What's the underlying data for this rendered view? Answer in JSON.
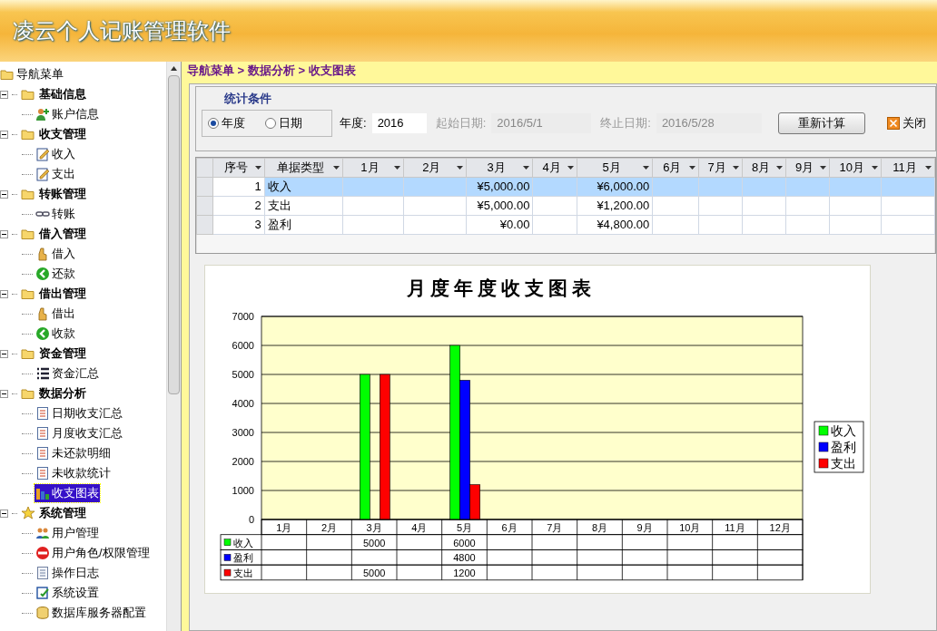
{
  "app_title": "凌云个人记账管理软件",
  "sidebar": {
    "label": "导航菜单",
    "children": [
      {
        "label": "基础信息",
        "expanded": true,
        "children": [
          {
            "label": "账户信息",
            "selected": false
          }
        ]
      },
      {
        "label": "收支管理",
        "expanded": true,
        "children": [
          {
            "label": "收入",
            "selected": false
          },
          {
            "label": "支出",
            "selected": false
          }
        ]
      },
      {
        "label": "转账管理",
        "expanded": true,
        "children": [
          {
            "label": "转账",
            "selected": false
          }
        ]
      },
      {
        "label": "借入管理",
        "expanded": true,
        "children": [
          {
            "label": "借入",
            "selected": false
          },
          {
            "label": "还款",
            "selected": false
          }
        ]
      },
      {
        "label": "借出管理",
        "expanded": true,
        "children": [
          {
            "label": "借出",
            "selected": false
          },
          {
            "label": "收款",
            "selected": false
          }
        ]
      },
      {
        "label": "资金管理",
        "expanded": true,
        "children": [
          {
            "label": "资金汇总",
            "selected": false
          }
        ]
      },
      {
        "label": "数据分析",
        "expanded": true,
        "children": [
          {
            "label": "日期收支汇总",
            "selected": false
          },
          {
            "label": "月度收支汇总",
            "selected": false
          },
          {
            "label": "未还款明细",
            "selected": false
          },
          {
            "label": "未收款统计",
            "selected": false
          },
          {
            "label": "收支图表",
            "selected": true
          }
        ]
      },
      {
        "label": "系统管理",
        "expanded": true,
        "children": [
          {
            "label": "用户管理",
            "selected": false
          },
          {
            "label": "用户角色/权限管理",
            "selected": false
          },
          {
            "label": "操作日志",
            "selected": false
          },
          {
            "label": "系统设置",
            "selected": false
          },
          {
            "label": "数据库服务器配置",
            "selected": false
          }
        ]
      }
    ]
  },
  "breadcrumb": "导航菜单 > 数据分析 > 收支图表",
  "filter": {
    "title": "统计条件",
    "modes": [
      {
        "label": "年度",
        "selected": true
      },
      {
        "label": "日期",
        "selected": false
      }
    ],
    "year": {
      "label": "年度:",
      "value": "2016",
      "disabled": false
    },
    "start": {
      "label": "起始日期:",
      "value": "2016/5/1",
      "disabled": true
    },
    "end": {
      "label": "终止日期:",
      "value": "2016/5/28",
      "disabled": true
    },
    "recalc_button": "重新计算",
    "close_button": "关闭"
  },
  "grid": {
    "columns": [
      "序号",
      "单据类型",
      "1月",
      "2月",
      "3月",
      "4月",
      "5月",
      "6月",
      "7月",
      "8月",
      "9月",
      "10月",
      "11月"
    ],
    "rows": [
      {
        "no": "1",
        "type": "收入",
        "selected": true,
        "month_3": "¥5,000.00",
        "month_5": "¥6,000.00"
      },
      {
        "no": "2",
        "type": "支出",
        "selected": false,
        "month_3": "¥5,000.00",
        "month_5": "¥1,200.00"
      },
      {
        "no": "3",
        "type": "盈利",
        "selected": false,
        "month_3": "¥0.00",
        "month_5": "¥4,800.00"
      }
    ]
  },
  "chart": {
    "chart_data": {
      "type": "bar",
      "title": "月度年度收支图表",
      "categories": [
        "1月",
        "2月",
        "3月",
        "4月",
        "5月",
        "6月",
        "7月",
        "8月",
        "9月",
        "10月",
        "11月",
        "12月"
      ],
      "series": [
        {
          "name": "收入",
          "color": "#00ff00",
          "values": [
            null,
            null,
            5000,
            null,
            6000,
            null,
            null,
            null,
            null,
            null,
            null,
            null
          ]
        },
        {
          "name": "盈利",
          "color": "#0000ff",
          "values": [
            null,
            null,
            null,
            null,
            4800,
            null,
            null,
            null,
            null,
            null,
            null,
            null
          ]
        },
        {
          "name": "支出",
          "color": "#ff0000",
          "values": [
            null,
            null,
            5000,
            null,
            1200,
            null,
            null,
            null,
            null,
            null,
            null,
            null
          ]
        }
      ],
      "ylim": [
        0,
        7000
      ],
      "yticks": [
        0,
        1000,
        2000,
        3000,
        4000,
        5000,
        6000,
        7000
      ],
      "grid": true,
      "legend": "right"
    },
    "data_table": {
      "rows": [
        {
          "label": "收入",
          "color": "#00ff00",
          "month_3": "5000",
          "month_5": "6000"
        },
        {
          "label": "盈利",
          "color": "#0000ff",
          "month_5": "4800"
        },
        {
          "label": "支出",
          "color": "#ff0000",
          "month_3": "5000",
          "month_5": "1200"
        }
      ]
    }
  }
}
